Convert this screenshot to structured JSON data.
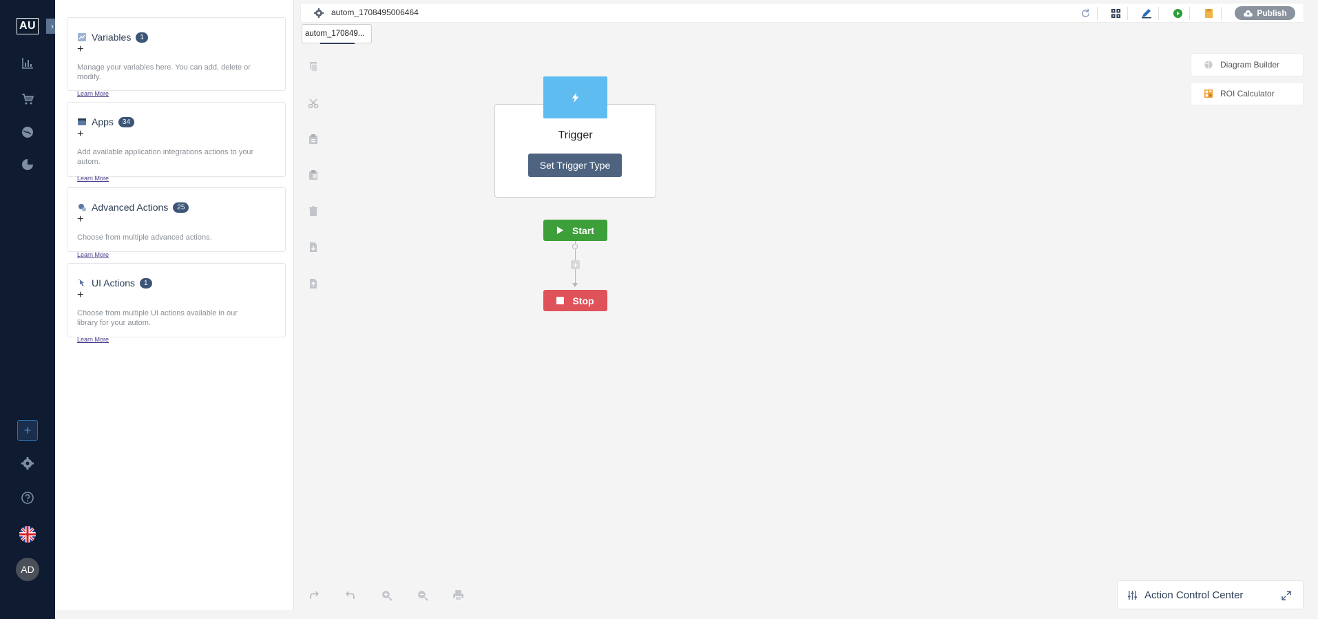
{
  "rail": {
    "logo": "AU",
    "avatar": "AD",
    "nav_items": [
      "analytics-icon",
      "cart-icon",
      "globe-icon",
      "pie-chart-icon"
    ],
    "bottom_items": [
      "add-icon",
      "gear-icon",
      "help-icon",
      "flag-uk-icon"
    ]
  },
  "panel": {
    "cards": [
      {
        "title": "Variables",
        "count": "1",
        "desc": "Manage your variables here. You can add, delete or modify.",
        "learn": "Learn More"
      },
      {
        "title": "Apps",
        "count": "34",
        "desc": "Add available application integrations actions to your autom.",
        "learn": "Learn More"
      },
      {
        "title": "Advanced Actions",
        "count": "25",
        "desc": "Choose from multiple advanced actions.",
        "learn": "Learn More"
      },
      {
        "title": "UI Actions",
        "count": "1",
        "desc": "Choose from multiple UI actions available in our library for your autom.",
        "learn": "Learn More"
      }
    ]
  },
  "topbar": {
    "autom_name": "autom_1708495006464",
    "publish_label": "Publish"
  },
  "tab": {
    "label": "autom_170849..."
  },
  "canvas": {
    "trigger_title": "Trigger",
    "trigger_button": "Set Trigger Type",
    "start_label": "Start",
    "stop_label": "Stop"
  },
  "side_buttons": {
    "diagram_builder": "Diagram Builder",
    "roi_calculator": "ROI Calculator"
  },
  "action_control_center": {
    "label": "Action Control Center"
  },
  "colors": {
    "rail_bg": "#0e1b30",
    "start": "#3d9f3a",
    "stop": "#e0525a",
    "trigger_icon": "#5fbcf0",
    "trigger_button": "#4d6380"
  }
}
